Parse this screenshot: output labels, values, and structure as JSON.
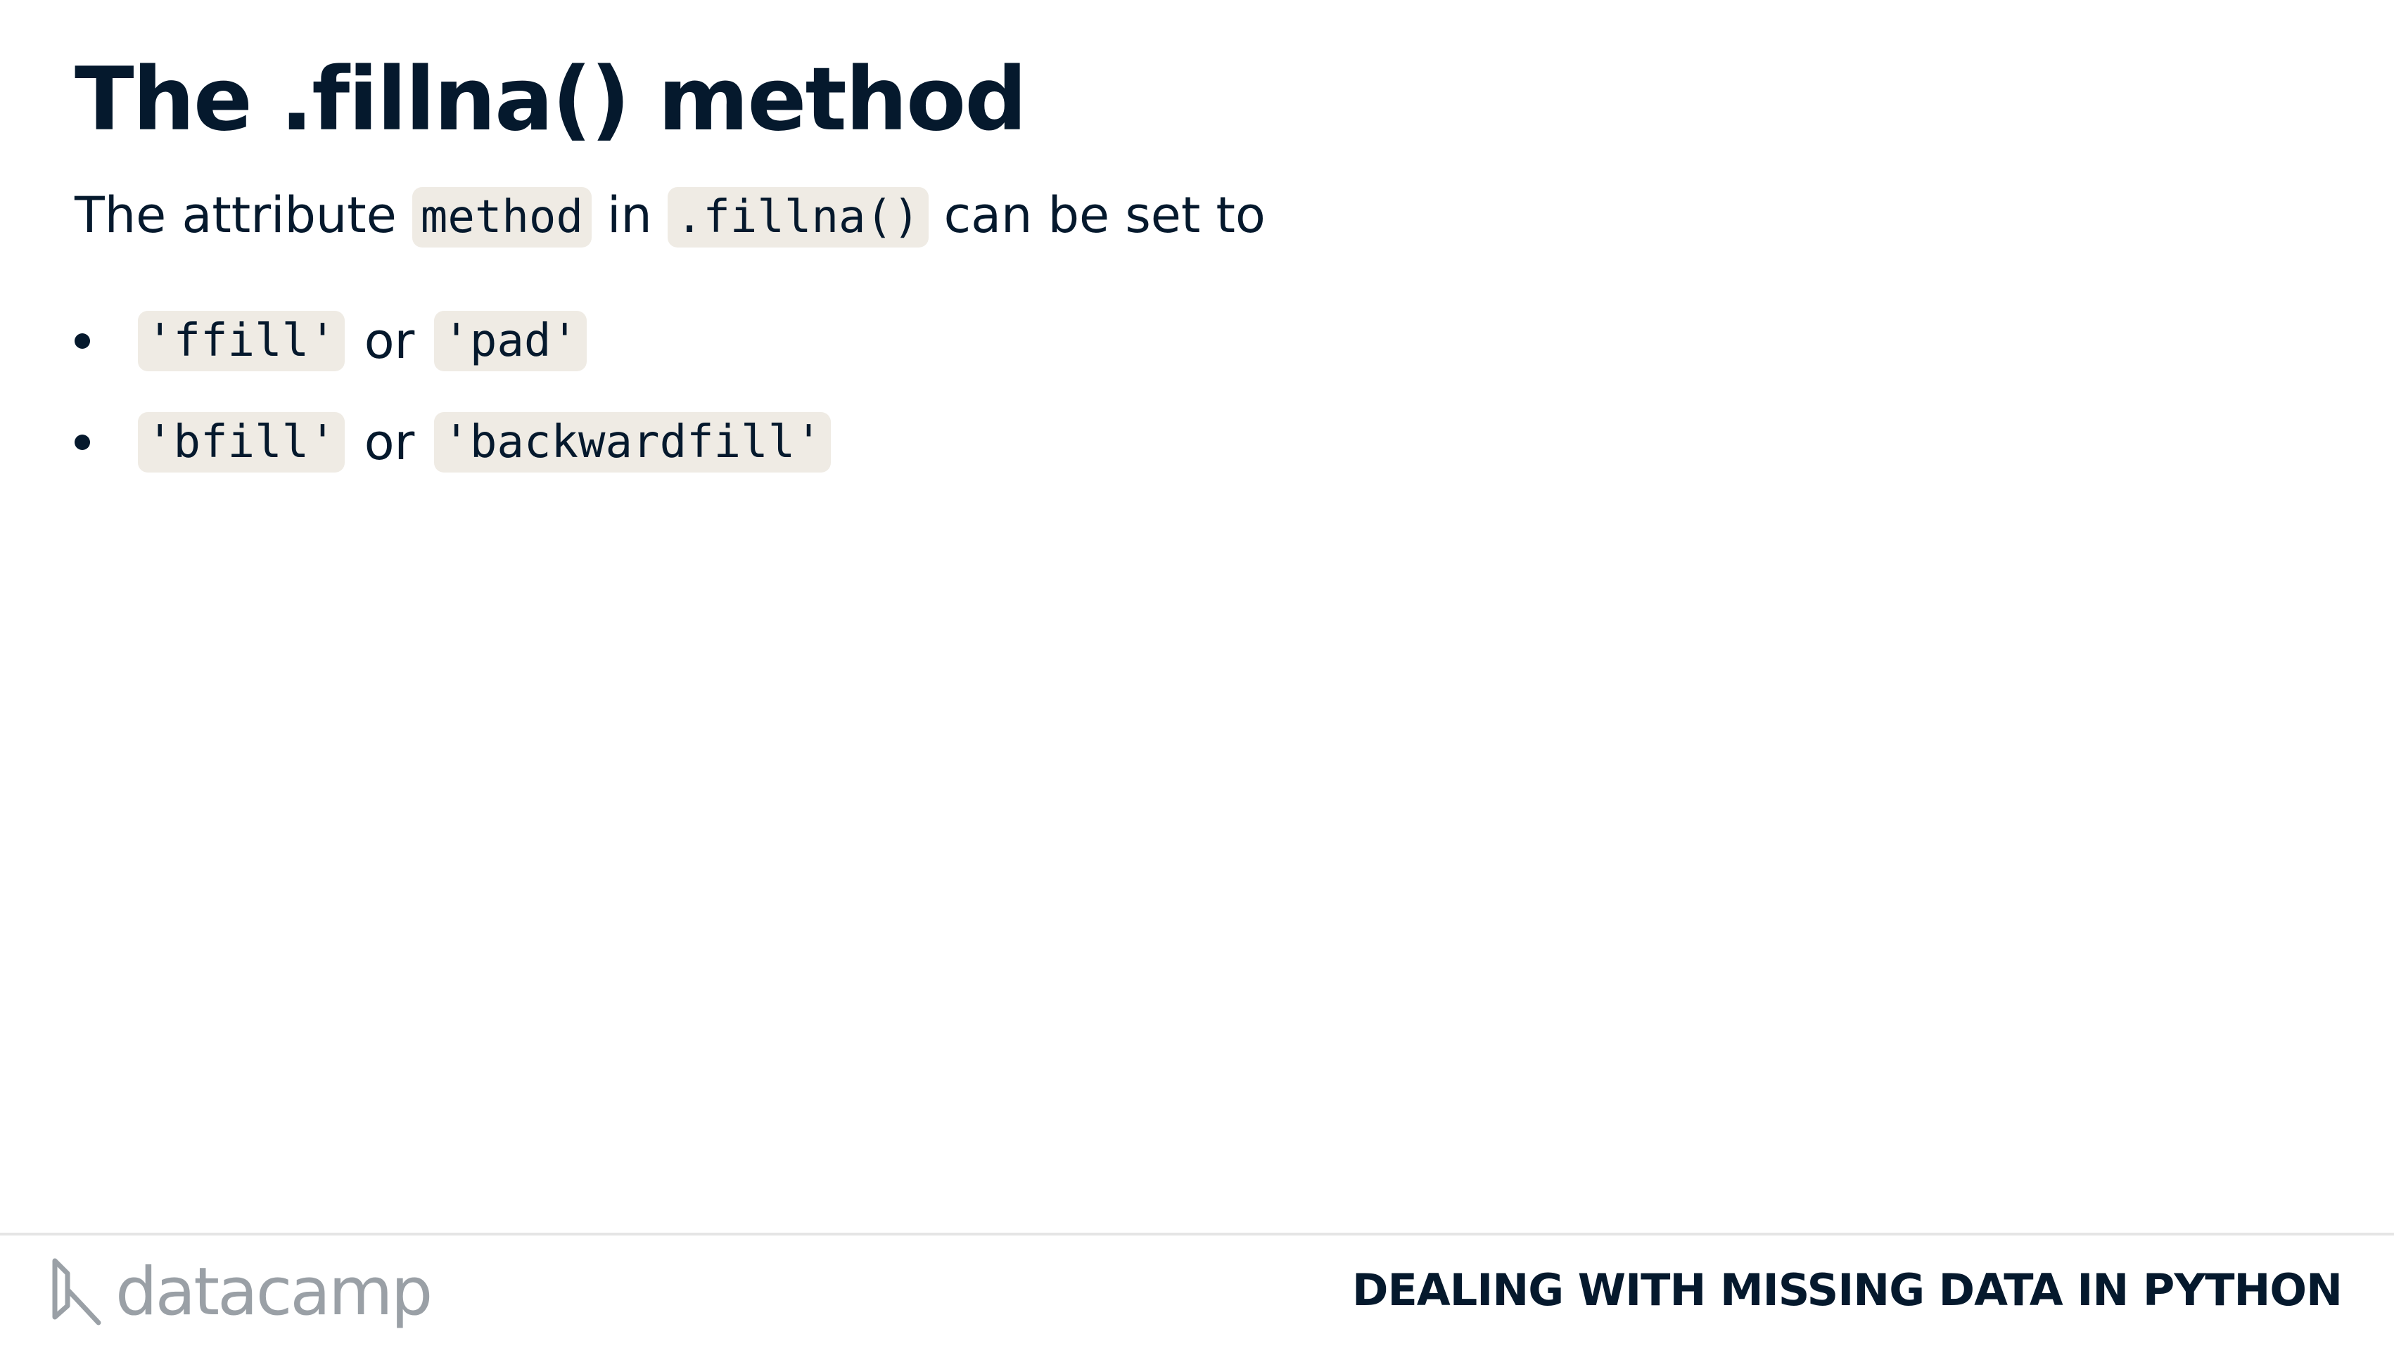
{
  "slide": {
    "title": "The .fillna() method",
    "intro": {
      "text_1": "The attribute",
      "code_1": "method",
      "text_2": "in",
      "code_2": ".fillna()",
      "text_3": "can be set to"
    },
    "bullets": [
      {
        "code_a": "'ffill'",
        "or": "or",
        "code_b": "'pad'"
      },
      {
        "code_a": "'bfill'",
        "or": "or",
        "code_b": "'backwardfill'"
      }
    ]
  },
  "footer": {
    "logo_text": "datacamp",
    "course_name": "DEALING WITH MISSING DATA IN PYTHON"
  },
  "colors": {
    "text": "#05192d",
    "code_background": "#efebe4",
    "logo_gray": "#9aa0a6"
  }
}
